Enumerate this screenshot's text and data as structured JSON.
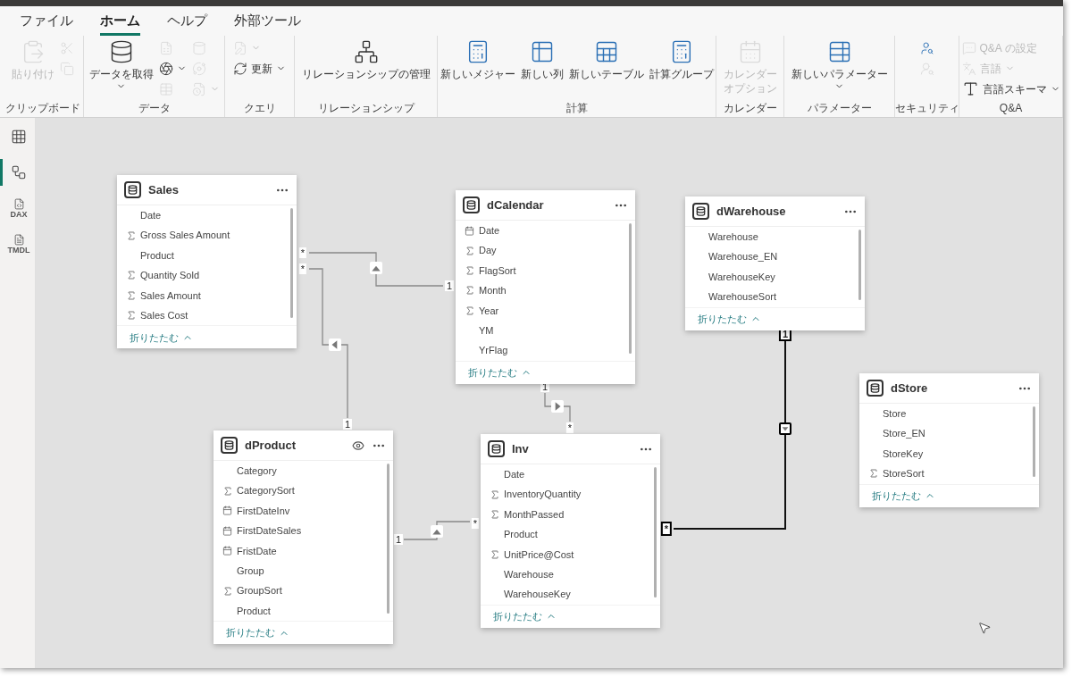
{
  "menu_tabs": [
    {
      "label": "ファイル",
      "selected": false
    },
    {
      "label": "ホーム",
      "selected": true
    },
    {
      "label": "ヘルプ",
      "selected": false
    },
    {
      "label": "外部ツール",
      "selected": false
    }
  ],
  "ribbon_groups": [
    {
      "label": "クリップボード",
      "items": [
        {
          "kind": "large",
          "label": "貼り付け",
          "disabled": true,
          "dropdown": false
        },
        {
          "kind": "small",
          "disabled": true,
          "dropdown": false
        },
        {
          "kind": "small",
          "disabled": true,
          "dropdown": false
        }
      ]
    },
    {
      "label": "データ",
      "items": [
        {
          "kind": "large",
          "label": "データを取得",
          "disabled": false,
          "dropdown": true
        },
        {
          "kind": "small",
          "disabled": true,
          "dropdown": false
        },
        {
          "kind": "small",
          "disabled": false,
          "dropdown": true
        },
        {
          "kind": "small",
          "disabled": true,
          "dropdown": false
        },
        {
          "kind": "small",
          "disabled": true,
          "dropdown": false
        },
        {
          "kind": "small",
          "disabled": true,
          "dropdown": false
        },
        {
          "kind": "small",
          "disabled": true,
          "dropdown": true
        }
      ]
    },
    {
      "label": "クエリ",
      "items": [
        {
          "kind": "small",
          "disabled": true,
          "dropdown": true
        },
        {
          "kind": "small",
          "label": "更新",
          "disabled": false,
          "dropdown": true
        }
      ]
    },
    {
      "label": "リレーションシップ",
      "items": [
        {
          "kind": "large",
          "label": "リレーションシップの管理",
          "disabled": false,
          "dropdown": false
        }
      ]
    },
    {
      "label": "計算",
      "items": [
        {
          "kind": "large",
          "label": "新しいメジャー",
          "disabled": false,
          "dropdown": false
        },
        {
          "kind": "large",
          "label": "新しい列",
          "disabled": false,
          "dropdown": false
        },
        {
          "kind": "large",
          "label": "新しいテーブル",
          "disabled": false,
          "dropdown": false
        },
        {
          "kind": "large",
          "label": "計算グループ",
          "disabled": false,
          "dropdown": false
        }
      ]
    },
    {
      "label": "カレンダー",
      "items": [
        {
          "kind": "large",
          "label": "カレンダーオプション",
          "disabled": true,
          "dropdown": false
        }
      ]
    },
    {
      "label": "パラメーター",
      "items": [
        {
          "kind": "large",
          "label": "新しいパラメーター",
          "disabled": false,
          "dropdown": true
        }
      ]
    },
    {
      "label": "セキュリティ",
      "items": [
        {
          "kind": "small",
          "disabled": false,
          "dropdown": false
        },
        {
          "kind": "small",
          "disabled": true,
          "dropdown": false
        }
      ]
    },
    {
      "label": "Q&A",
      "items": [
        {
          "kind": "small",
          "label": "Q&A の設定",
          "disabled": true,
          "dropdown": false
        },
        {
          "kind": "small",
          "label": "言語",
          "disabled": true,
          "dropdown": true
        },
        {
          "kind": "small",
          "label": "言語スキーマ",
          "disabled": false,
          "dropdown": true
        }
      ]
    }
  ],
  "sidebar_items": [
    {
      "selected": false
    },
    {
      "selected": true
    },
    {
      "label": "DAX",
      "selected": false
    },
    {
      "label": "TMDL",
      "selected": false
    }
  ],
  "tables": [
    {
      "name": "Sales",
      "view_icon": false,
      "collapse_label": "折りたたむ",
      "fields": [
        {
          "name": "Date",
          "kind": "plain"
        },
        {
          "name": "Gross Sales Amount",
          "kind": "sum"
        },
        {
          "name": "Product",
          "kind": "plain"
        },
        {
          "name": "Quantity Sold",
          "kind": "sum"
        },
        {
          "name": "Sales Amount",
          "kind": "sum"
        },
        {
          "name": "Sales Cost",
          "kind": "sum"
        }
      ]
    },
    {
      "name": "dCalendar",
      "view_icon": false,
      "collapse_label": "折りたたむ",
      "fields": [
        {
          "name": "Date",
          "kind": "date"
        },
        {
          "name": "Day",
          "kind": "sum"
        },
        {
          "name": "FlagSort",
          "kind": "sum"
        },
        {
          "name": "Month",
          "kind": "sum"
        },
        {
          "name": "Year",
          "kind": "sum"
        },
        {
          "name": "YM",
          "kind": "plain"
        },
        {
          "name": "YrFlag",
          "kind": "plain"
        }
      ]
    },
    {
      "name": "dWarehouse",
      "view_icon": false,
      "collapse_label": "折りたたむ",
      "fields": [
        {
          "name": "Warehouse",
          "kind": "plain"
        },
        {
          "name": "Warehouse_EN",
          "kind": "plain"
        },
        {
          "name": "WarehouseKey",
          "kind": "plain"
        },
        {
          "name": "WarehouseSort",
          "kind": "plain"
        }
      ]
    },
    {
      "name": "dStore",
      "view_icon": false,
      "collapse_label": "折りたたむ",
      "fields": [
        {
          "name": "Store",
          "kind": "plain"
        },
        {
          "name": "Store_EN",
          "kind": "plain"
        },
        {
          "name": "StoreKey",
          "kind": "plain"
        },
        {
          "name": "StoreSort",
          "kind": "sum"
        }
      ]
    },
    {
      "name": "dProduct",
      "view_icon": true,
      "collapse_label": "折りたたむ",
      "fields": [
        {
          "name": "Category",
          "kind": "plain"
        },
        {
          "name": "CategorySort",
          "kind": "sum"
        },
        {
          "name": "FirstDateInv",
          "kind": "date"
        },
        {
          "name": "FirstDateSales",
          "kind": "date"
        },
        {
          "name": "FristDate",
          "kind": "date"
        },
        {
          "name": "Group",
          "kind": "plain"
        },
        {
          "name": "GroupSort",
          "kind": "sum"
        },
        {
          "name": "Product",
          "kind": "plain"
        }
      ]
    },
    {
      "name": "Inv",
      "view_icon": false,
      "collapse_label": "折りたたむ",
      "fields": [
        {
          "name": "Date",
          "kind": "plain"
        },
        {
          "name": "InventoryQuantity",
          "kind": "sum"
        },
        {
          "name": "MonthPassed",
          "kind": "sum"
        },
        {
          "name": "Product",
          "kind": "plain"
        },
        {
          "name": "UnitPrice@Cost",
          "kind": "sum"
        },
        {
          "name": "Warehouse",
          "kind": "plain"
        },
        {
          "name": "WarehouseKey",
          "kind": "plain"
        }
      ]
    }
  ],
  "relationships": [
    {
      "from_label": "*",
      "to_label": "1",
      "kind": "up",
      "selected": false
    },
    {
      "from_label": "*",
      "to_label": "1",
      "kind": "left",
      "selected": false
    },
    {
      "from_label": "1",
      "to_label": "*",
      "kind": "right",
      "selected": false
    },
    {
      "from_label": "1",
      "to_label": "*",
      "kind": "up",
      "selected": false
    },
    {
      "from_label": "1",
      "to_label": "*",
      "kind": "down",
      "selected": true
    }
  ]
}
